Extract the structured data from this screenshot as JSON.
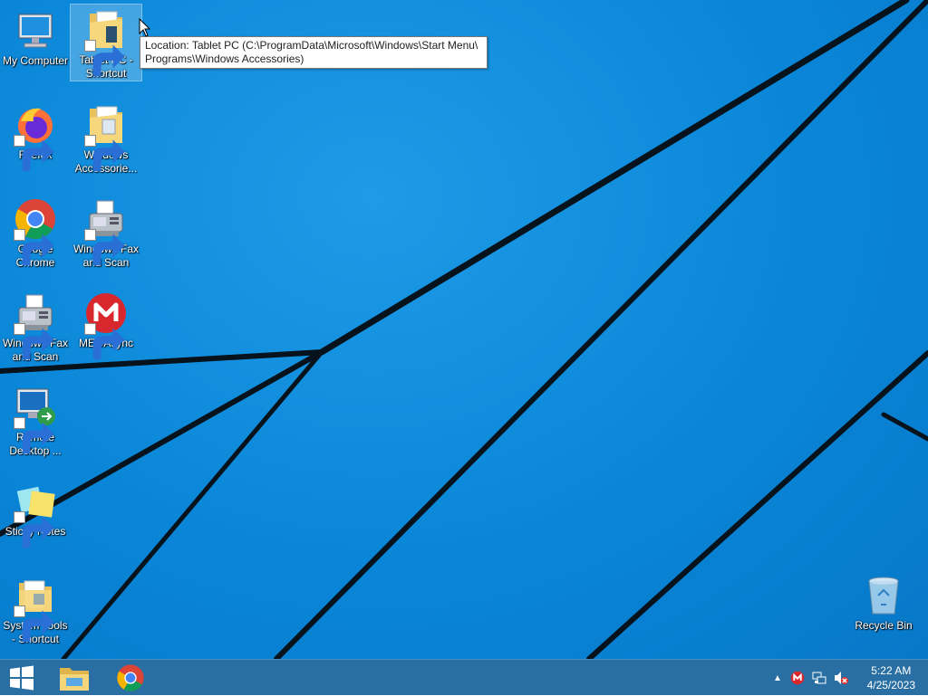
{
  "desktop": {
    "icons": [
      {
        "label": "My Computer",
        "icon": "computer-icon"
      },
      {
        "label": "Tablet PC - Shortcut",
        "icon": "folder-icon"
      },
      {
        "label": "Firefox",
        "icon": "firefox-icon"
      },
      {
        "label": "Windows Accessorie...",
        "icon": "folder-icon"
      },
      {
        "label": "Google Chrome",
        "icon": "chrome-icon"
      },
      {
        "label": "Windows Fax and Scan",
        "icon": "fax-icon"
      },
      {
        "label": "Windows Fax and Scan",
        "icon": "fax-icon"
      },
      {
        "label": "MEGAsync",
        "icon": "mega-icon"
      },
      {
        "label": "Remote Desktop ...",
        "icon": "remote-desktop-icon"
      },
      {
        "label": "Sticky Notes",
        "icon": "sticky-notes-icon"
      },
      {
        "label": "System Tools - Shortcut",
        "icon": "folder-icon"
      },
      {
        "label": "Recycle Bin",
        "icon": "recycle-bin-icon"
      }
    ],
    "tooltip": "Location: Tablet PC (C:\\ProgramData\\Microsoft\\Windows\\Start Menu\\ Programs\\Windows Accessories)"
  },
  "taskbar": {
    "start": "windows-logo-icon",
    "pinned": [
      "file-explorer-icon",
      "chrome-icon"
    ],
    "tray": [
      "show-hidden-icons-chevron",
      "mega-icon",
      "network-icon",
      "volume-muted-icon"
    ],
    "time": "5:22 AM",
    "date": "4/25/2023"
  },
  "colors": {
    "taskbar": "#2a6fa3",
    "wallpaper": "#0a86d8"
  }
}
